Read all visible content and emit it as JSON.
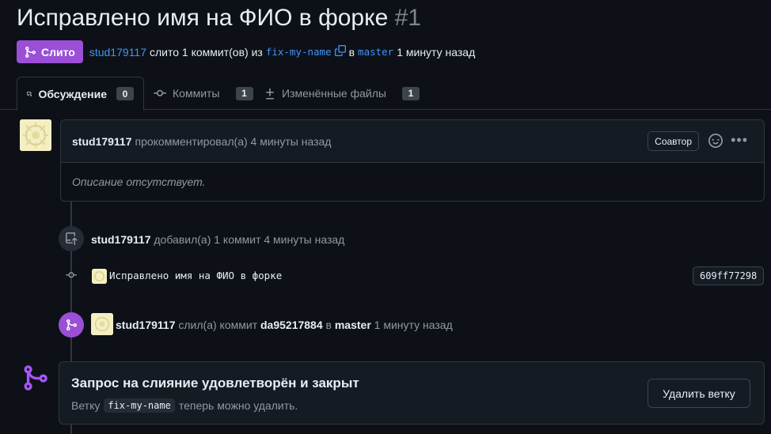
{
  "pr": {
    "title": "Исправлено имя на ФИО в форке",
    "number": "#1",
    "state": "Слито",
    "author": "stud179117",
    "merged_text": "слито 1 коммит(ов) из",
    "head_branch": "fix-my-name",
    "into_word": "в",
    "base_branch": "master",
    "time": "1 минуту назад"
  },
  "tabs": [
    {
      "label": "Обсуждение",
      "count": "0",
      "icon": "comment-discussion-icon"
    },
    {
      "label": "Коммиты",
      "count": "1",
      "icon": "git-commit-icon"
    },
    {
      "label": "Изменённые файлы",
      "count": "1",
      "icon": "file-diff-icon"
    }
  ],
  "comment": {
    "author": "stud179117",
    "action": "прокомментировал(а) 4 минуты назад",
    "role_badge": "Соавтор",
    "body": "Описание отсутствует."
  },
  "timeline": {
    "push_author": "stud179117",
    "push_text": "добавил(а) 1 коммит 4 минуты назад",
    "commit_message": "Исправлено имя на ФИО в форке",
    "commit_sha": "609ff77298",
    "merge_author": "stud179117",
    "merge_text1": "слил(а) коммит",
    "merge_sha": "da95217884",
    "merge_text2": "в",
    "merge_branch": "master",
    "merge_time": "1 минуту назад"
  },
  "merged_box": {
    "title": "Запрос на слияние удовлетворён и закрыт",
    "desc_prefix": "Ветку",
    "branch": "fix-my-name",
    "desc_suffix": "теперь можно удалить.",
    "delete_button": "Удалить ветку"
  },
  "colors": {
    "merged": "#9a4fd6",
    "link": "#4493f8",
    "background": "#0d1117"
  }
}
